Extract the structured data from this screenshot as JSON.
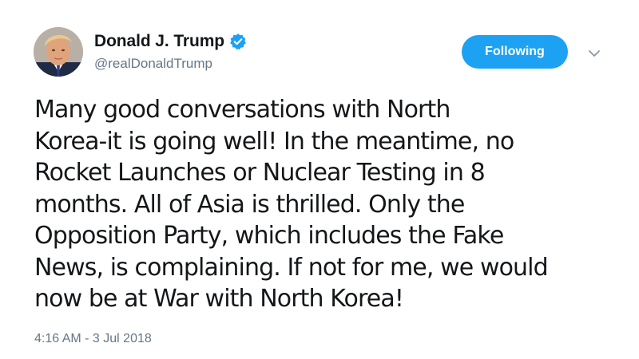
{
  "author": {
    "display_name": "Donald J. Trump",
    "handle": "@realDonaldTrump",
    "verified": true,
    "avatar_icon": "profile-photo"
  },
  "actions": {
    "follow_label": "Following",
    "more_icon": "chevron-down-icon"
  },
  "tweet": {
    "lines": [
      "Many good conversations with North",
      "Korea-it is going well! In the meantime, no",
      "Rocket Launches or Nuclear Testing in 8",
      "months. All of Asia is thrilled. Only the",
      "Opposition Party, which includes the Fake",
      "News, is complaining. If not for me, we would",
      "now be at War with North Korea!"
    ],
    "timestamp": "4:16 AM - 3 Jul 2018"
  },
  "colors": {
    "accent": "#1da1f2",
    "text_primary": "#14171a",
    "text_secondary": "#657786"
  }
}
